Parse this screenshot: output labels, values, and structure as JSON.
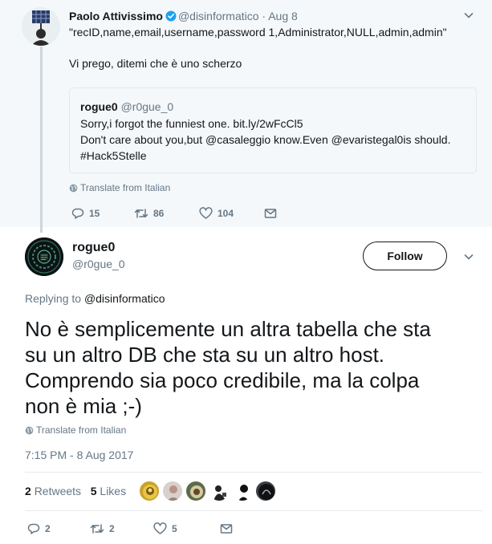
{
  "parent_tweet": {
    "name": "Paolo Attivissimo",
    "handle": "@disinformatico",
    "separator": "·",
    "date": "Aug 8",
    "text_line1": "\"recID,name,email,username,password 1,Administrator,NULL,admin,admin\"",
    "text_line2": "Vi prego, ditemi che è uno scherzo",
    "quoted": {
      "name": "rogue0",
      "handle": "@r0gue_0",
      "line1": "Sorry,i forgot the funniest one. bit.ly/2wFcCl5",
      "line2": "Don't care about you,but @casaleggio know.Even @evaristegal0is should.",
      "line3": "#Hack5Stelle"
    },
    "translate_label": "Translate from Italian",
    "actions": {
      "replies": "15",
      "retweets": "86",
      "likes": "104"
    }
  },
  "main_tweet": {
    "name": "rogue0",
    "handle": "@r0gue_0",
    "follow_label": "Follow",
    "replying_prefix": "Replying to",
    "replying_mention": "@disinformatico",
    "text_lines": [
      "No è semplicemente un altra tabella che sta",
      "su un altro DB che sta su un altro host.",
      "Comprendo sia poco credibile, ma la colpa",
      "non è mia ;-)"
    ],
    "translate_label": "Translate from Italian",
    "timestamp": "7:15 PM - 8 Aug 2017",
    "stats": {
      "retweets_count": "2",
      "retweets_label": "Retweets",
      "likes_count": "5",
      "likes_label": "Likes"
    },
    "actions": {
      "replies": "2",
      "retweets": "2",
      "likes": "5"
    }
  },
  "colors": {
    "verified": "#1da1f2",
    "secondary_text": "#657786",
    "primary_text": "#14171a",
    "parent_background": "#f5f8fa"
  },
  "icons": [
    "verified-badge-icon",
    "chevron-down-icon",
    "globe-icon",
    "reply-icon",
    "retweet-icon",
    "like-icon",
    "direct-message-icon"
  ]
}
